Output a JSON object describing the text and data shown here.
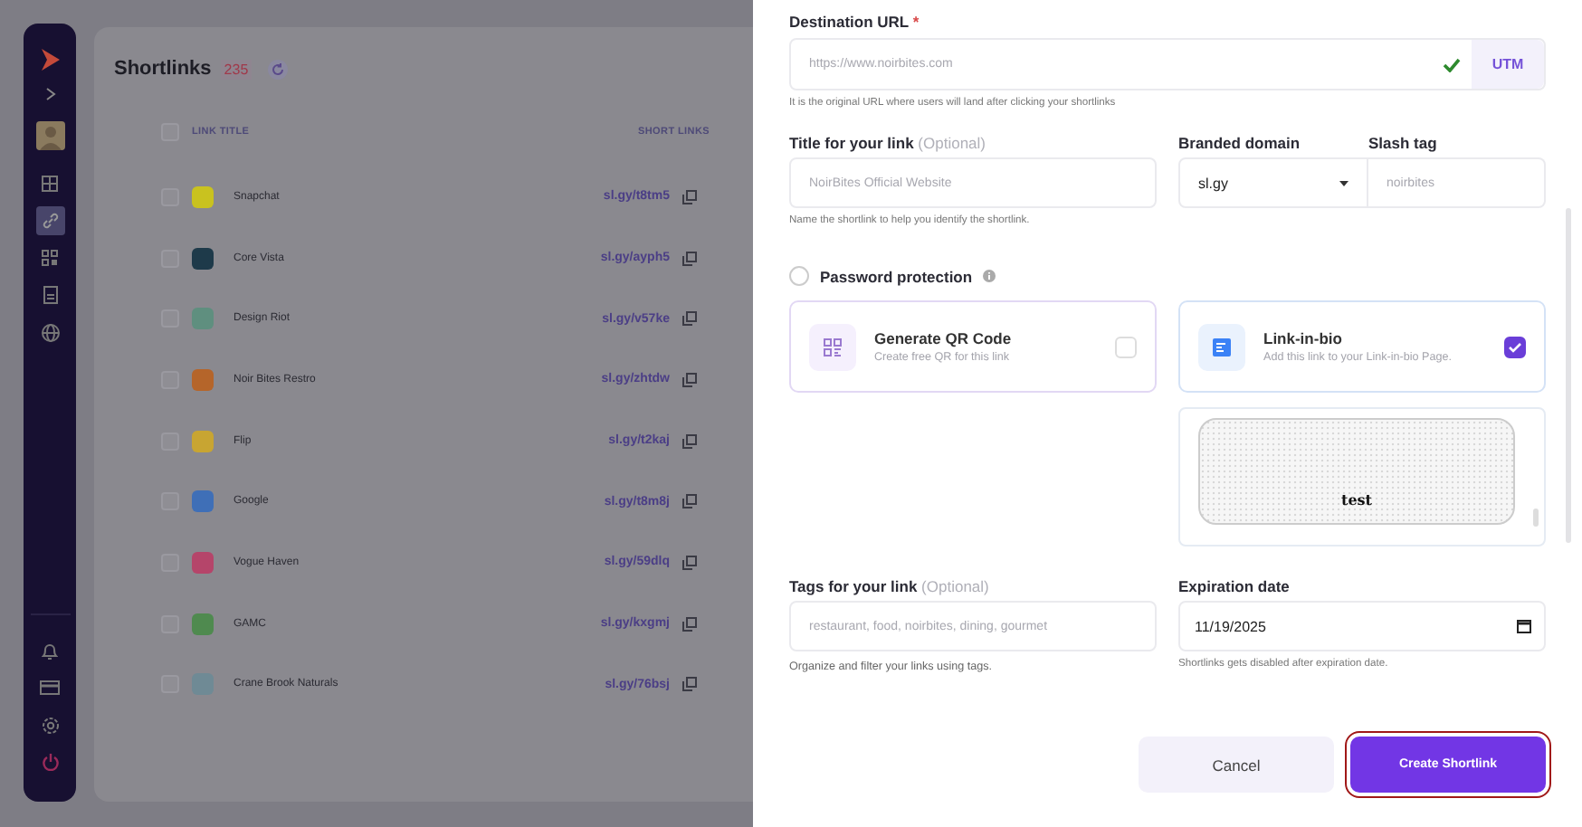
{
  "sidebar": {
    "top_items": [
      {
        "kind": "expand",
        "selected": false
      },
      {
        "kind": "avatar",
        "selected": false
      },
      {
        "kind": "dashboard",
        "selected": false
      },
      {
        "kind": "links",
        "selected": true
      },
      {
        "kind": "qr",
        "selected": false
      },
      {
        "kind": "pages",
        "selected": false
      },
      {
        "kind": "globe",
        "selected": false
      }
    ],
    "bottom_items": [
      {
        "kind": "bell",
        "selected": false
      },
      {
        "kind": "card",
        "selected": false
      },
      {
        "kind": "settings",
        "selected": false
      },
      {
        "kind": "power",
        "selected": false
      }
    ]
  },
  "list": {
    "title": "Shortlinks",
    "count": "235",
    "columns": [
      "LINK TITLE",
      "SHORT LINKS"
    ],
    "select_all_checked": false,
    "rows": [
      {
        "title": "Snapchat",
        "short_link": "sl.gy/t8tm5",
        "color": "#c9c21f",
        "checked": false
      },
      {
        "title": "Core Vista",
        "short_link": "sl.gy/ayph5",
        "color": "#1e3a4a",
        "checked": false
      },
      {
        "title": "Design Riot",
        "short_link": "sl.gy/v57ke",
        "color": "#5f8f7f",
        "checked": false
      },
      {
        "title": "Noir Bites Restro",
        "short_link": "sl.gy/zhtdw",
        "color": "#b5652a",
        "checked": false
      },
      {
        "title": "Flip",
        "short_link": "sl.gy/t2kaj",
        "color": "#c8a532",
        "checked": false
      },
      {
        "title": "Google",
        "short_link": "sl.gy/t8m8j",
        "color": "#3f6fb7",
        "checked": false
      },
      {
        "title": "Vogue Haven",
        "short_link": "sl.gy/59dlq",
        "color": "#b5456a",
        "checked": false
      },
      {
        "title": "GAMC",
        "short_link": "sl.gy/kxgmj",
        "color": "#4f8a4f",
        "checked": false
      },
      {
        "title": "Crane Brook Naturals",
        "short_link": "sl.gy/76bsj",
        "color": "#6f8a95",
        "checked": false
      }
    ]
  },
  "form": {
    "destination": {
      "label": "Destination URL",
      "required_mark": "*",
      "placeholder": "https://www.noirbites.com",
      "valid": true,
      "utm_button": "UTM",
      "help": "It is the original URL where users will land after clicking your shortlinks"
    },
    "title": {
      "label": "Title for your link",
      "optional": "(Optional)",
      "placeholder": "NoirBites Official Website",
      "help": "Name the shortlink to help you identify the shortlink."
    },
    "branded_domain": {
      "label": "Branded domain",
      "value": "sl.gy"
    },
    "slash_tag": {
      "label": "Slash tag",
      "placeholder": "noirbites"
    },
    "password_protection": {
      "label": "Password protection",
      "checked": false
    },
    "options": [
      {
        "kind": "qr",
        "title": "Generate QR Code",
        "description": "Create free QR for this link",
        "checked": false
      },
      {
        "kind": "bio",
        "title": "Link-in-bio",
        "description": "Add this link to your Link-in-bio Page.",
        "checked": true
      }
    ],
    "preview": {
      "text": "test"
    },
    "tags": {
      "label": "Tags for your link",
      "optional": "(Optional)",
      "placeholder": "restaurant, food, noirbites, dining, gourmet",
      "help": "Organize and filter your links using tags."
    },
    "expiration": {
      "label": "Expiration date",
      "value": "11/19/2025",
      "help": "Shortlinks gets disabled after expiration  date."
    },
    "buttons": [
      {
        "kind": "secondary",
        "label": "Cancel",
        "highlighted": false
      },
      {
        "kind": "primary",
        "label": "Create Shortlink",
        "highlighted": true
      }
    ]
  }
}
